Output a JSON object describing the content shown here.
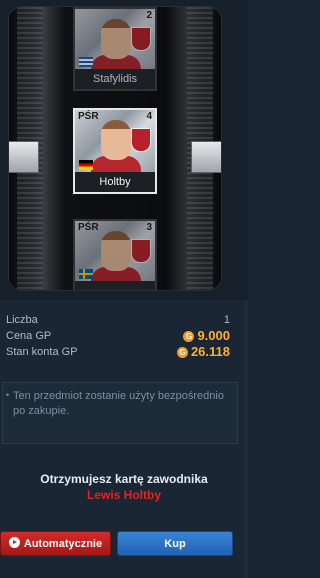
{
  "carousel": {
    "cards": [
      {
        "position": "",
        "number": "2",
        "name": "Stafylidis",
        "flag": "flag-gr"
      },
      {
        "position": "PŚR",
        "number": "4",
        "name": "Holtby",
        "flag": "flag-de"
      },
      {
        "position": "PŚR",
        "number": "3",
        "name": "",
        "flag": "flag-se"
      }
    ]
  },
  "info": {
    "quantity_label": "Liczba",
    "quantity_value": "1",
    "price_label": "Cena GP",
    "price_value": "9.000",
    "balance_label": "Stan konta GP",
    "balance_value": "26.118",
    "coin_symbol": "G"
  },
  "note": {
    "text": "Ten przedmiot zostanie użyty bezpośrednio po zakupie."
  },
  "receive": {
    "line1": "Otrzymujesz kartę zawodnika",
    "player_name": "Lewis Holtby"
  },
  "buttons": {
    "auto_label": "Automatycznie",
    "buy_label": "Kup"
  },
  "colors": {
    "price": "#ffb12b",
    "player_name": "#e02424",
    "buy_button": "#2a70c4",
    "auto_button": "#c42222"
  }
}
